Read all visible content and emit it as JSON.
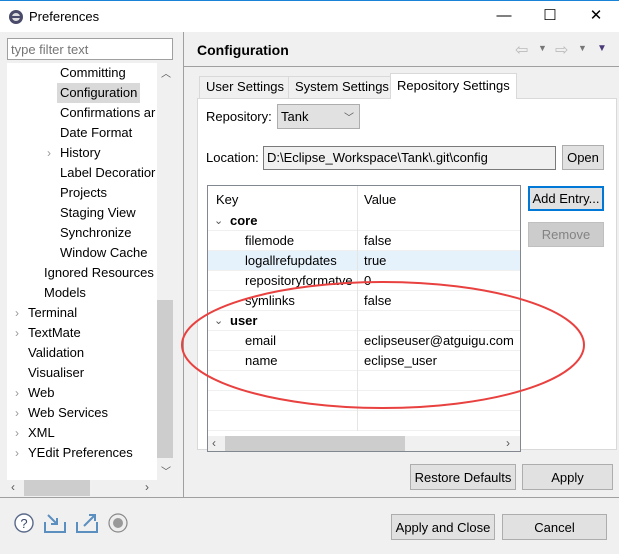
{
  "window": {
    "title": "Preferences",
    "minimize": "—",
    "maximize": "☐",
    "close": "✕"
  },
  "filter": {
    "placeholder": "type filter text"
  },
  "tree": [
    {
      "label": "Committing",
      "indent": 3,
      "chevron": false
    },
    {
      "label": "Configuration",
      "indent": 3,
      "chevron": false,
      "selected": true
    },
    {
      "label": "Confirmations ar",
      "indent": 3,
      "chevron": false
    },
    {
      "label": "Date Format",
      "indent": 3,
      "chevron": false
    },
    {
      "label": "History",
      "indent": 3,
      "chevron": true
    },
    {
      "label": "Label Decoratior",
      "indent": 3,
      "chevron": false
    },
    {
      "label": "Projects",
      "indent": 3,
      "chevron": false
    },
    {
      "label": "Staging View",
      "indent": 3,
      "chevron": false
    },
    {
      "label": "Synchronize",
      "indent": 3,
      "chevron": false
    },
    {
      "label": "Window Cache",
      "indent": 3,
      "chevron": false
    },
    {
      "label": "Ignored Resources",
      "indent": 2,
      "chevron": false
    },
    {
      "label": "Models",
      "indent": 2,
      "chevron": false
    },
    {
      "label": "Terminal",
      "indent": 1,
      "chevron": true
    },
    {
      "label": "TextMate",
      "indent": 1,
      "chevron": true
    },
    {
      "label": "Validation",
      "indent": 1,
      "chevron": false
    },
    {
      "label": "Visualiser",
      "indent": 1,
      "chevron": false
    },
    {
      "label": "Web",
      "indent": 1,
      "chevron": true
    },
    {
      "label": "Web Services",
      "indent": 1,
      "chevron": true
    },
    {
      "label": "XML",
      "indent": 1,
      "chevron": true
    },
    {
      "label": "YEdit Preferences",
      "indent": 1,
      "chevron": true
    }
  ],
  "page": {
    "title": "Configuration"
  },
  "tabs": [
    "User Settings",
    "System Settings",
    "Repository Settings"
  ],
  "active_tab": 2,
  "repository": {
    "label": "Repository:",
    "value": "Tank"
  },
  "location": {
    "label": "Location:",
    "value": "D:\\Eclipse_Workspace\\Tank\\.git\\config",
    "open": "Open"
  },
  "table": {
    "headers": [
      "Key",
      "Value"
    ],
    "rows": [
      {
        "key": "core",
        "value": "",
        "section": true
      },
      {
        "key": "filemode",
        "value": "false"
      },
      {
        "key": "logallrefupdates",
        "value": "true",
        "selected": true
      },
      {
        "key": "repositoryformatve",
        "value": "0"
      },
      {
        "key": "symlinks",
        "value": "false"
      },
      {
        "key": "user",
        "value": "",
        "section": true
      },
      {
        "key": "email",
        "value": "eclipseuser@atguigu.com"
      },
      {
        "key": "name",
        "value": "eclipse_user"
      }
    ]
  },
  "buttons": {
    "add_entry": "Add Entry...",
    "remove": "Remove",
    "restore": "Restore Defaults",
    "apply": "Apply",
    "apply_close": "Apply and Close",
    "cancel": "Cancel"
  },
  "colors": {
    "accent": "#0078d7",
    "annotation": "#e8413f",
    "selection": "#e5f1fb"
  }
}
